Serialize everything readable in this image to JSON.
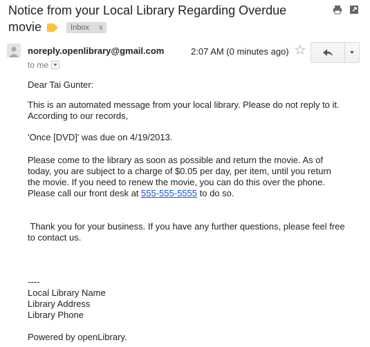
{
  "subject": {
    "line1": "Notice from your Local Library Regarding Overdue",
    "line2": "movie"
  },
  "labels": {
    "inbox": "Inbox",
    "remove": "x"
  },
  "header": {
    "sender": "noreply.openlibrary@gmail.com",
    "to": "to me",
    "time": "2:07 AM (0 minutes ago)"
  },
  "icons": {
    "print": "print-icon",
    "popout": "new-window-icon",
    "avatar": "avatar-icon",
    "star": "star-icon",
    "reply": "reply-icon",
    "more": "chevron-down-icon",
    "label": "label-tag-icon"
  },
  "message": {
    "greeting": "Dear Tai Gunter:",
    "p1_l1": "This is an automated message from your local library. Please do not reply to it.",
    "p1_l2": "According to our records,",
    "p2": "'Once [DVD]' was due on 4/19/2013.",
    "p3_l1": "Please come to the library as soon as possible and return the movie. As of",
    "p3_l2": "today, you are subject to a charge of $0.05 per day, per item, until you return",
    "p3_l3": "the movie. If you need to renew the movie, you can do this over the phone.",
    "p3_l4_pre": "Please call our front desk at ",
    "phone": "555-555-5555",
    "p3_l4_post": " to do so.",
    "p4_l1": " Thank you for your business. If you have any further questions, please feel free",
    "p4_l2": "to contact us.",
    "sig_sep": "----",
    "sig_name": "Local Library Name",
    "sig_address": "Library Address",
    "sig_phone": "Library Phone",
    "powered": "Powered by openLibrary."
  }
}
